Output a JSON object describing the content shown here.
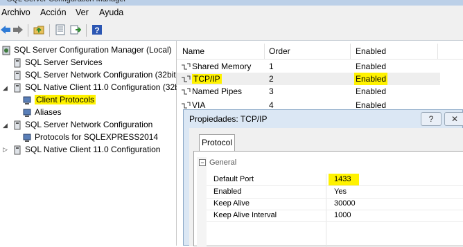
{
  "menu": [
    "Archivo",
    "Acción",
    "Ver",
    "Ayuda"
  ],
  "tree": {
    "root": "SQL Server Configuration Manager (Local)",
    "items": [
      "SQL Server Services",
      "SQL Server Network Configuration (32bit",
      "SQL Native Client 11.0 Configuration (32b",
      "Client Protocols",
      "Aliases",
      "SQL Server Network Configuration",
      "Protocols for SQLEXPRESS2014",
      "SQL Native Client 11.0 Configuration"
    ]
  },
  "list": {
    "headers": [
      "Name",
      "Order",
      "Enabled"
    ],
    "rows": [
      {
        "name": "Shared Memory",
        "order": "1",
        "enabled": "Enabled"
      },
      {
        "name": "TCP/IP",
        "order": "2",
        "enabled": "Enabled"
      },
      {
        "name": "Named Pipes",
        "order": "3",
        "enabled": "Enabled"
      },
      {
        "name": "VIA",
        "order": "4",
        "enabled": "Enabled"
      }
    ]
  },
  "dialog": {
    "title": "Propiedades: TCP/IP",
    "help_label": "?",
    "close_label": "✕",
    "tab": "Protocol",
    "category": "General",
    "properties": [
      {
        "name": "Default Port",
        "value": "1433"
      },
      {
        "name": "Enabled",
        "value": "Yes"
      },
      {
        "name": "Keep Alive",
        "value": "30000"
      },
      {
        "name": "Keep Alive Interval",
        "value": "1000"
      }
    ]
  },
  "colors": {
    "highlight": "#fff200",
    "dialog_frame": "#dbe7f4",
    "selection": "#eeeeee"
  },
  "icons": [
    "back-icon",
    "forward-icon",
    "up-folder-icon",
    "properties-icon",
    "export-icon",
    "help-icon"
  ]
}
